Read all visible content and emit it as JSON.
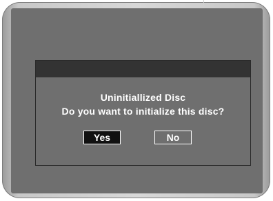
{
  "dialog": {
    "title": "Uninitiallized Disc",
    "question": "Do you want to initialize this disc?",
    "buttons": {
      "yes": "Yes",
      "no": "No"
    },
    "selected_button": "yes"
  },
  "colors": {
    "screen_background": "#6f6f6f",
    "titlebar": "#333333",
    "selected_button_fill": "#111111",
    "text": "#ffffff",
    "bezel": "#c8c8c8"
  }
}
